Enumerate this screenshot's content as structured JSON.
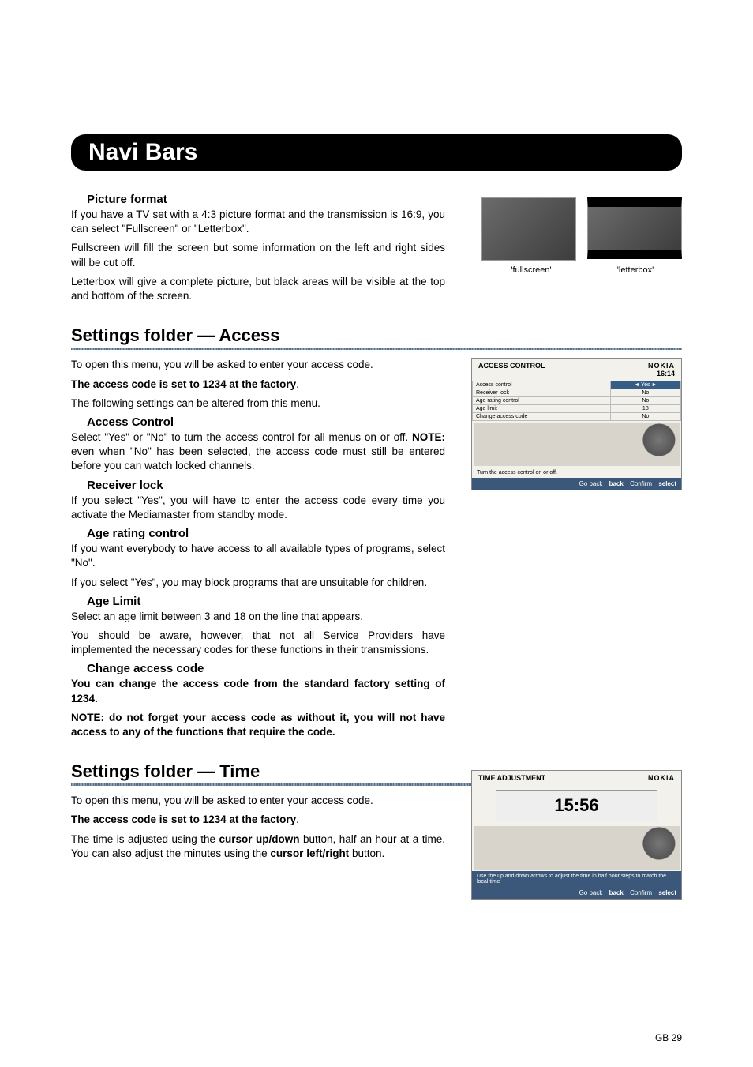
{
  "page_title": "Navi Bars",
  "page_number": "GB 29",
  "picture_format": {
    "heading": "Picture format",
    "p1": "If you have a TV set with a 4:3 picture format and the transmission is 16:9, you can select \"Fullscreen\" or \"Letterbox\".",
    "p2": "Fullscreen will fill the screen but some information on the left and right sides will be cut off.",
    "p3": "Letterbox will give a complete picture, but black areas will be visible at the top and bottom of the screen.",
    "caption_full": "'fullscreen'",
    "caption_letter": "'letterbox'"
  },
  "access": {
    "heading": "Settings folder — Access",
    "intro1": "To open this menu, you will be asked to enter your access code.",
    "intro2": "The access code is set to 1234 at the factory",
    "intro3": "The following settings can be altered from this menu.",
    "access_control": {
      "heading": "Access Control",
      "p1a": "Select \"Yes\" or \"No\" to turn the access control for all menus on or off. ",
      "p1b": "NOTE:",
      "p1c": " even when \"No\" has been selected, the access code must still be entered before you can watch locked channels."
    },
    "receiver_lock": {
      "heading": "Receiver lock",
      "p1": "If you select \"Yes\", you will have to enter the access code every time you activate the Mediamaster from standby mode."
    },
    "age_rating": {
      "heading": "Age rating control",
      "p1": "If you want everybody to have access to all available types of programs, select \"No\".",
      "p2": "If you select \"Yes\", you may block programs that are unsuitable for children."
    },
    "age_limit": {
      "heading": "Age Limit",
      "p1": "Select an age limit between 3 and 18 on the line that appears.",
      "p2": "You should be aware, however, that not all Service Providers have implemented the necessary codes for these functions in their transmissions."
    },
    "change_code": {
      "heading": "Change access code",
      "p1": "You can change the access code from the standard factory setting of 1234.",
      "p2": "NOTE: do not forget your access code as without it, you will not have access to any of the functions that require the code."
    },
    "screenshot": {
      "title": "ACCESS CONTROL",
      "brand": "NOKIA",
      "clock": "16:14",
      "rows": [
        {
          "label": "Access control",
          "value": "Yes"
        },
        {
          "label": "Receiver lock",
          "value": "No"
        },
        {
          "label": "Age rating control",
          "value": "No"
        },
        {
          "label": "Age limit",
          "value": "18"
        },
        {
          "label": "Change access code",
          "value": "No"
        }
      ],
      "hint": "Turn the access control on or off.",
      "btn_back_label": "Go back",
      "btn_back_key": "back",
      "btn_conf_label": "Confirm",
      "btn_conf_key": "select"
    }
  },
  "time": {
    "heading": "Settings folder — Time",
    "intro1": "To open this menu, you will be asked to enter your access code.",
    "intro2": "The access code is set to 1234 at the factory",
    "p1a": "The time is adjusted using the ",
    "p1b": "cursor up/down",
    "p1c": " button, half an hour at a time. You can also adjust the minutes using the ",
    "p1d": "cursor left/right",
    "p1e": " button.",
    "screenshot": {
      "title": "TIME ADJUSTMENT",
      "brand": "NOKIA",
      "value": "15:56",
      "hint": "Use the up and down arrows to adjust the time in half hour steps to match the local time",
      "btn_back_label": "Go back",
      "btn_back_key": "back",
      "btn_conf_label": "Confirm",
      "btn_conf_key": "select"
    }
  }
}
